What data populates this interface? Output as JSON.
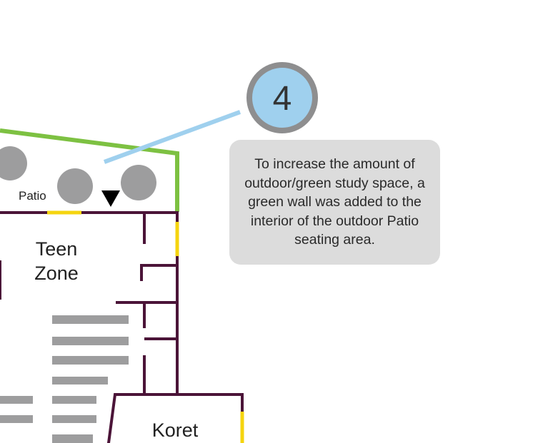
{
  "rooms": {
    "patio": "Patio",
    "teen_zone_line1": "Teen",
    "teen_zone_line2": "Zone",
    "koret": "Koret"
  },
  "marker": {
    "number": "4"
  },
  "callout": {
    "text": "To increase the amount of outdoor/green study space, a green wall was added to the interior of the outdoor Patio seating area."
  },
  "colors": {
    "wall": "#4b1438",
    "green_wall": "#7dc142",
    "door": "#f5d40f",
    "seat": "#9d9d9e",
    "marker_fill": "#9fd0ee",
    "marker_ring": "#8e8e8f",
    "leader": "#9fd0ee",
    "callout_bg": "#dcdcdc"
  }
}
